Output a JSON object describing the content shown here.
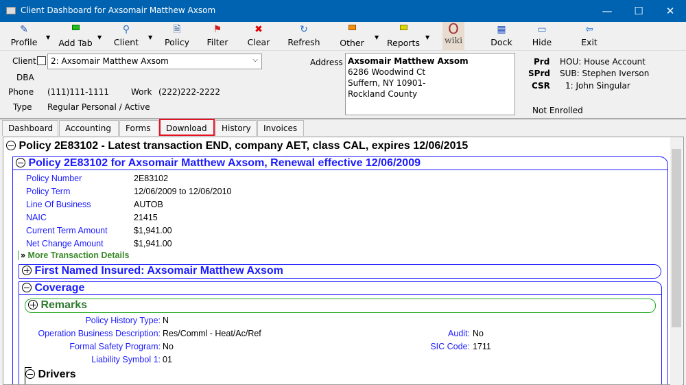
{
  "window": {
    "title": "Client Dashboard for Axsomair Matthew Axsom",
    "minimize": "—",
    "maximize": "☐",
    "close": "✕"
  },
  "toolbar": [
    {
      "label": "Profile",
      "icon": "pen-icon"
    },
    {
      "label": "Add Tab",
      "icon": "green-tab-icon"
    },
    {
      "label": "Client",
      "icon": "magnifier-icon"
    },
    {
      "label": "Policy",
      "icon": "policy-search-icon"
    },
    {
      "label": "Filter",
      "icon": "filter-icon"
    },
    {
      "label": "Clear",
      "icon": "red-x-icon"
    },
    {
      "label": "Refresh",
      "icon": "refresh-icon"
    },
    {
      "label": "Other",
      "icon": "orange-tab-icon"
    },
    {
      "label": "Reports",
      "icon": "yellow-tab-icon"
    },
    {
      "label": "wiki",
      "icon": "wiki-logo"
    },
    {
      "label": "Dock",
      "icon": "dock-icon"
    },
    {
      "label": "Hide",
      "icon": "hide-icon"
    },
    {
      "label": "Exit",
      "icon": "exit-icon"
    }
  ],
  "client": {
    "client_label": "Client",
    "client_value": "2: Axsomair Matthew Axsom",
    "dba_label": "DBA",
    "phone_label": "Phone",
    "phone": "(111)111-1111",
    "work_label": "Work",
    "work": "(222)222-2222",
    "type_label": "Type",
    "type": "Regular Personal / Active",
    "address_label": "Address",
    "address": [
      "Axsomair Matthew Axsom",
      "6286 Woodwind Ct",
      "Suffern, NY 10901-",
      "Rockland County"
    ],
    "prd_label": "Prd",
    "prd": "HOU: House Account",
    "sprd_label": "SPrd",
    "sprd": "SUB: Stephen Iverson",
    "csr_label": "CSR",
    "csr": "1: John Singular",
    "enrollment": "Not Enrolled"
  },
  "tabs": [
    "Dashboard",
    "Accounting",
    "Forms",
    "Download",
    "History",
    "Invoices"
  ],
  "highlighted_tab": "Download",
  "content": {
    "policy_header": "Policy 2E83102 - Latest transaction END, company AET, class CAL, expires 12/06/2015",
    "renewal_header": "Policy 2E83102 for Axsomair Matthew Axsom, Renewal effective 12/06/2009",
    "fields": [
      {
        "label": "Policy Number",
        "value": "2E83102"
      },
      {
        "label": "Policy Term",
        "value": "12/06/2009 to 12/06/2010"
      },
      {
        "label": "Line Of Business",
        "value": "AUTOB"
      },
      {
        "label": "NAIC",
        "value": "21415"
      },
      {
        "label": "Current Term Amount",
        "value": "$1,941.00"
      },
      {
        "label": "Net Change Amount",
        "value": "$1,941.00"
      }
    ],
    "more_details": "More Transaction Details",
    "first_named": "First Named Insured: Axsomair Matthew Axsom",
    "coverage": "Coverage",
    "remarks": "Remarks",
    "coverage_fields_left": [
      {
        "label": "Policy History Type:",
        "value": "N"
      },
      {
        "label": "Operation Business Description:",
        "value": "Res/Comml - Heat/Ac/Ref"
      },
      {
        "label": "Formal Safety Program:",
        "value": "No"
      },
      {
        "label": "Liability Symbol 1:",
        "value": "01"
      }
    ],
    "coverage_fields_right": [
      {
        "label": "Audit:",
        "value": "No"
      },
      {
        "label": "SIC Code:",
        "value": "1711"
      }
    ],
    "drivers": "Drivers"
  }
}
